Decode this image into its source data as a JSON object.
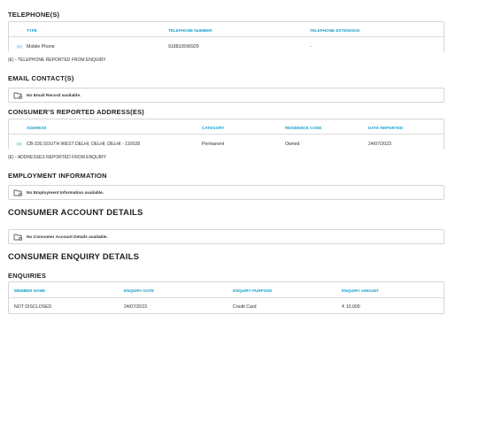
{
  "telephones": {
    "heading": "TELEPHONE(S)",
    "columns": [
      "TYPE",
      "TELEPHONE NUMBER",
      "TELEPHONE EXTENSION"
    ],
    "rows": [
      {
        "tag": "(e)",
        "type": "Mobile Phone",
        "number": "918810596929",
        "extension": "-"
      }
    ],
    "footnote": "(e) - TELEPHONE REPORTED FROM ENQUIRY"
  },
  "email": {
    "heading": "EMAIL CONTACT(S)",
    "empty_text": "No Email Record available."
  },
  "addresses": {
    "heading": "CONSUMER'S REPORTED ADDRESS(ES)",
    "columns": [
      "ADDRESS",
      "CATEGORY",
      "RESIDENCE CODE",
      "DATE REPORTED"
    ],
    "rows": [
      {
        "tag": "(e)",
        "address": "CB-330,SOUTH WEST DELHI, DELHI, DELHI - 110028",
        "category": "Permanent",
        "residence_code": "Owned",
        "date_reported": "24/07/2023"
      }
    ],
    "footnote": "(e) - ADDRESSES REPORTED FROM ENQUIRY"
  },
  "employment": {
    "heading": "EMPLOYMENT INFORMATION",
    "empty_text": "No Employment Information available."
  },
  "accounts": {
    "heading": "CONSUMER ACCOUNT DETAILS",
    "empty_text": "No Consumer Account Details available."
  },
  "enquiry_details": {
    "heading": "CONSUMER ENQUIRY DETAILS"
  },
  "enquiries": {
    "heading": "ENQUIRIES",
    "columns": [
      "MEMBER NAME",
      "ENQUIRY DATE",
      "ENQUIRY PURPOSE",
      "ENQUIRY AMOUNT"
    ],
    "rows": [
      {
        "member_name": "NOT DISCLOSED",
        "enquiry_date": "24/07/2023",
        "purpose": "Credit Card",
        "amount": "₹ 10,000"
      }
    ]
  },
  "icon": "empty-folder-icon",
  "accent_color": "#1aa0cc"
}
